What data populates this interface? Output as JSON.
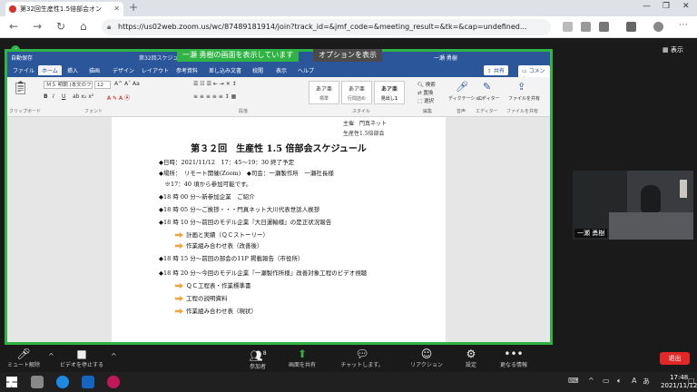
{
  "browser": {
    "tab_title": "第32回生産性1.5倍部会オン",
    "url": "https://us02web.zoom.us/wc/87489181914/join?track_id=&jmf_code=&meeting_result=&tk=&cap=undefined..."
  },
  "share": {
    "banner": "一瀬 勇樹の画面を表示しています",
    "options_label": "オプションを表示",
    "view_label": "表示"
  },
  "word": {
    "autosave": "自動保存",
    "doc_title": "第32回スケジュール_2021.11...",
    "user": "一瀬 勇樹",
    "tabs": [
      "ファイル",
      "ホーム",
      "挿入",
      "描画",
      "デザイン",
      "レイアウト",
      "参考資料",
      "差し込み文書",
      "校閲",
      "表示",
      "ヘルプ"
    ],
    "share_btn": "共有",
    "comment_btn": "コメント",
    "font_name": "ＭＳ 明朝 (本文のフ",
    "font_size": "12",
    "groups": [
      "クリップボード",
      "フォント",
      "段落",
      "スタイル",
      "編集",
      "音声",
      "エディター",
      "ファイルを共有"
    ],
    "styles": [
      {
        "preview": "あア亜",
        "name": "標準"
      },
      {
        "preview": "あア亜",
        "name": "行間詰め"
      },
      {
        "preview": "あア亜",
        "name": "見出し1"
      }
    ],
    "right_tools": [
      "検索",
      "置換",
      "選択",
      "ディクテーション",
      "エディター",
      "ファイルを共有"
    ]
  },
  "doc": {
    "header_lines": [
      "主催　門真ネット",
      "生産性1.5倍部会"
    ],
    "title": "第３２回　生産性 1.5 倍部会スケジュール",
    "lines": [
      {
        "text": "◆日時：2021/11/12　17：45～19：30 終了予定",
        "arrow": false
      },
      {
        "text": "◆場所：　リモート開催(Zoom)　◆司会：一瀬製作所　一瀬社長様",
        "arrow": false
      },
      {
        "text": "　※17：40 頃から参加可能です。",
        "arrow": false
      },
      {
        "text": "◆18 時 00 分～新参加企業　ご紹介",
        "arrow": false
      },
      {
        "text": "◆18 時 05 分～ご挨拶・・・門真ネット大川代表世話人挨拶",
        "arrow": false
      },
      {
        "text": "◆18 時 10 分～前回のモデル企業『大日運輸様』の是正状況報告",
        "arrow": false
      },
      {
        "text": "計画と実績（ＱＣストーリー）",
        "arrow": true
      },
      {
        "text": "作業組み合わせ表（改善後）",
        "arrow": true
      },
      {
        "text": "◆18 時 15 分～前回の部会の11P 掲載報告（市役所）",
        "arrow": false
      },
      {
        "text": "◆18 時 20 分～今回のモデル企業『一瀬製作所様』改善対象工程のビデオ視聴",
        "arrow": false
      },
      {
        "text": "ＱＣ工程表・作業標準書",
        "arrow": true
      },
      {
        "text": "工程の説明資料",
        "arrow": true
      },
      {
        "text": "作業組み合わせ表（現状）",
        "arrow": true
      }
    ]
  },
  "video": {
    "name": "一瀬 勇樹"
  },
  "toolbar": {
    "mute": "ミュート解除",
    "video": "ビデオを停止する",
    "participants": "参加者",
    "participants_count": "8",
    "share_screen": "画面を共有",
    "chat": "チャットします。",
    "reactions": "リアクション",
    "settings": "設定",
    "more": "更なる情報",
    "leave": "退出"
  },
  "taskbar": {
    "time": "17:48",
    "date": "2021/11/12",
    "ime": "あ"
  }
}
